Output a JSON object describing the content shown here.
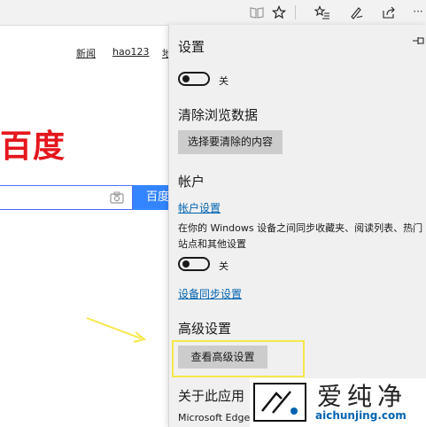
{
  "toolbar": {
    "icons": [
      "reading-view-icon",
      "favorite-star-icon",
      "favorites-hub-icon",
      "web-note-pen-icon",
      "share-icon",
      "more-icon"
    ],
    "more_label": "···"
  },
  "baidu": {
    "nav_links": [
      "新闻",
      "hao123",
      "地"
    ],
    "logo_text": "百度",
    "search_button_label": "百度一下"
  },
  "settings": {
    "title": "设置",
    "toggle1_label": "关",
    "clear_data_heading": "清除浏览数据",
    "clear_button": "选择要清除的内容",
    "account_heading": "帐户",
    "account_settings_link": "帐户设置",
    "sync_desc": "在你的 Windows 设备之间同步收藏夹、阅读列表、热门站点和其他设置",
    "toggle2_label": "关",
    "device_sync_link": "设备同步设置",
    "advanced_heading": "高级设置",
    "advanced_button": "查看高级设置",
    "about_heading": "关于此应用",
    "about_text": "Microsoft Edge"
  },
  "annotation": {
    "highlight_color": "#f5e84a",
    "arrow_color": "#f5e84a"
  },
  "watermark": {
    "text": "爱纯净",
    "url": "aichunjing.com"
  }
}
